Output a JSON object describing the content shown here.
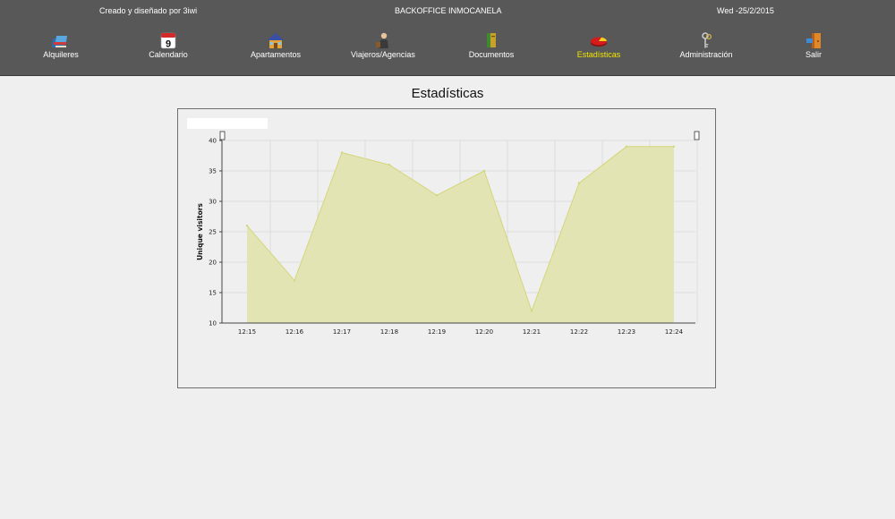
{
  "header": {
    "credit": "Creado y diseñado por 3iwi",
    "title": "BACKOFFICE INMOCANELA",
    "date": "Wed -25/2/2015"
  },
  "nav": {
    "items": [
      {
        "label": "Alquileres",
        "icon": "books-icon"
      },
      {
        "label": "Calendario",
        "icon": "calendar-icon",
        "icon_text": "9"
      },
      {
        "label": "Apartamentos",
        "icon": "house-icon"
      },
      {
        "label": "Viajeros/Agencias",
        "icon": "traveler-icon"
      },
      {
        "label": "Documentos",
        "icon": "document-icon"
      },
      {
        "label": "Estadísticas",
        "icon": "pie-chart-icon",
        "active": true
      },
      {
        "label": "Administración",
        "icon": "keys-icon"
      },
      {
        "label": "Salir",
        "icon": "exit-door-icon"
      }
    ],
    "active_color": "#f2e600"
  },
  "page": {
    "title": "Estadísticas"
  },
  "chart_data": {
    "type": "area",
    "ylabel": "Unique visitors",
    "categories": [
      "12:15",
      "12:16",
      "12:17",
      "12:18",
      "12:19",
      "12:20",
      "12:21",
      "12:22",
      "12:23",
      "12:24"
    ],
    "values": [
      26,
      17,
      38,
      36,
      31,
      35,
      12,
      33,
      39,
      39
    ],
    "ylim": [
      10,
      40
    ],
    "yticks": [
      10,
      15,
      20,
      25,
      30,
      35,
      40
    ],
    "grid": true,
    "fill_color": "#e3e4b4",
    "line_color": "#d4d67a"
  }
}
